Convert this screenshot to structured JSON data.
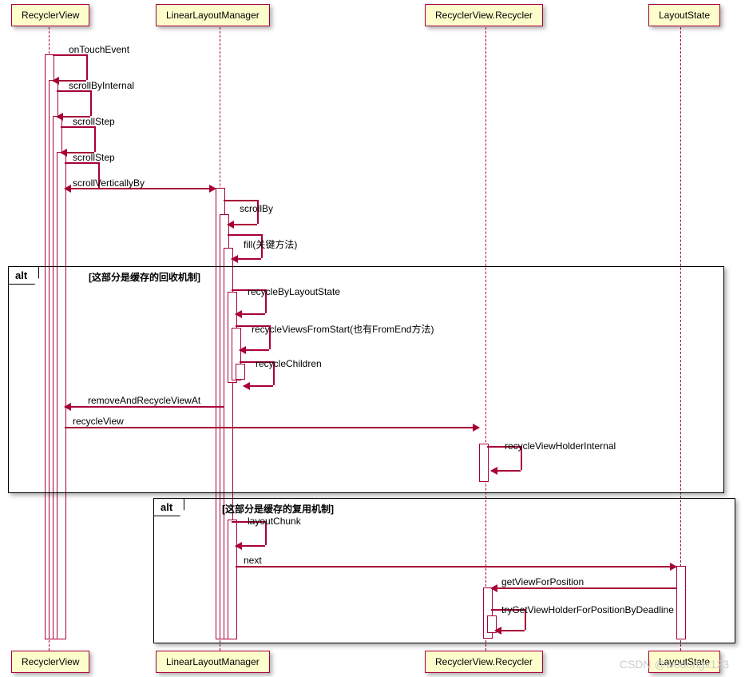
{
  "participants": {
    "p1": "RecyclerView",
    "p2": "LinearLayoutManager",
    "p3": "RecyclerView.Recycler",
    "p4": "LayoutState"
  },
  "messages": {
    "m1": "onTouchEvent",
    "m2": "scrollByInternal",
    "m3": "scrollStep",
    "m4": "scrollStep",
    "m5": "scrollVerticallyBy",
    "m6": "scrollBy",
    "m7": "fill(关键方法)",
    "m8": "recycleByLayoutState",
    "m9": "recycleViewsFromStart(也有FromEnd方法)",
    "m10": "recycleChildren",
    "m11": "removeAndRecycleViewAt",
    "m12": "recycleView",
    "m13": "recycleViewHolderInternal",
    "m14": "layoutChunk",
    "m15": "next",
    "m16": "getViewForPosition",
    "m17": "tryGetViewHolderForPositionByDeadline"
  },
  "alt": {
    "tag": "alt",
    "cond1": "[这部分是缓存的回收机制]",
    "cond2": "[这部分是缓存的复用机制]"
  },
  "watermark": "CSDN @wodongx123"
}
